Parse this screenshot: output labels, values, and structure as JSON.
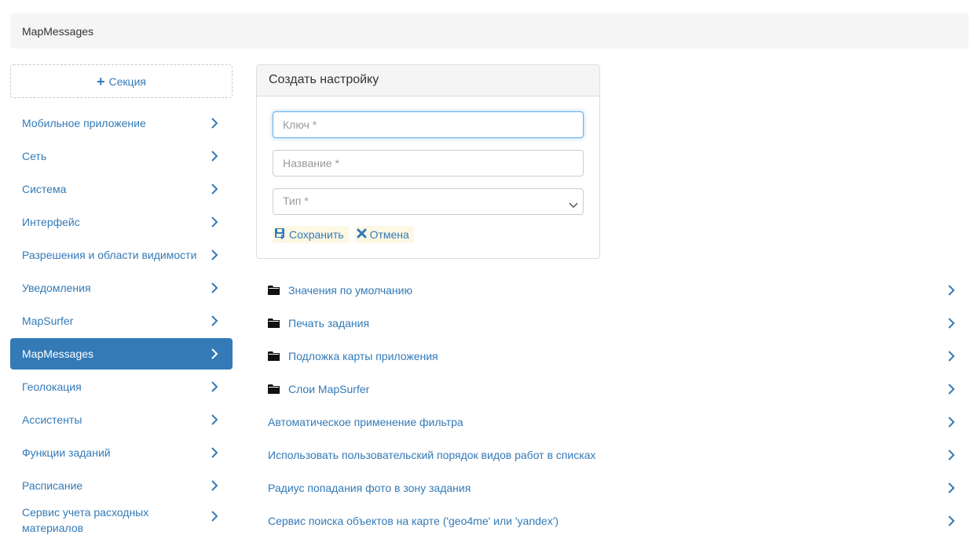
{
  "breadcrumb": {
    "title": "MapMessages"
  },
  "sidebar": {
    "add_label": "Секция",
    "items": [
      {
        "label": "Мобильное приложение"
      },
      {
        "label": "Сеть"
      },
      {
        "label": "Система"
      },
      {
        "label": "Интерфейс"
      },
      {
        "label": "Разрешения и области видимости"
      },
      {
        "label": "Уведомления"
      },
      {
        "label": "MapSurfer"
      },
      {
        "label": "MapMessages",
        "active": true
      },
      {
        "label": "Геолокация"
      },
      {
        "label": "Ассистенты"
      },
      {
        "label": "Функции заданий"
      },
      {
        "label": "Расписание"
      },
      {
        "label": "Сервис учета расходных материалов"
      }
    ]
  },
  "form": {
    "heading": "Создать настройку",
    "key_placeholder": "Ключ *",
    "name_placeholder": "Название *",
    "type_placeholder": "Тип *",
    "save_label": "Сохранить",
    "cancel_label": "Отмена"
  },
  "list": {
    "folders": [
      {
        "label": "Значения по умолчанию"
      },
      {
        "label": "Печать задания"
      },
      {
        "label": "Подложка карты приложения"
      },
      {
        "label": "Слои MapSurfer"
      }
    ],
    "settings": [
      {
        "label": "Автоматическое применение фильтра"
      },
      {
        "label": "Использовать пользовательский порядок видов работ в списках"
      },
      {
        "label": "Радиус попадания фото в зону задания"
      },
      {
        "label": "Сервис поиска объектов на карте ('geo4me' или 'yandex')"
      }
    ]
  },
  "colors": {
    "accent": "#337ab7",
    "active_bg": "#337ab7",
    "button_bg": "#fcf8e3"
  }
}
